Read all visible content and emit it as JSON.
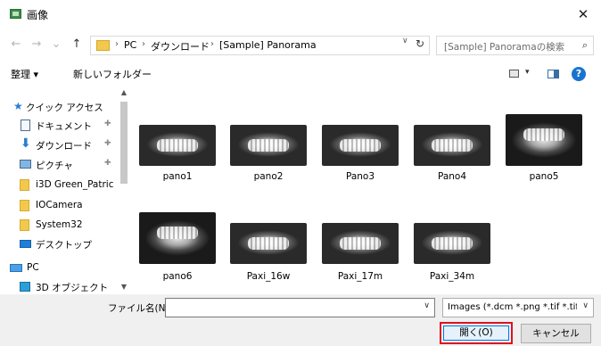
{
  "window": {
    "title": "画像",
    "close_glyph": "✕"
  },
  "nav": {
    "back": "←",
    "forward": "→",
    "recent": "⌄",
    "up": "↑"
  },
  "address": {
    "crumbs": [
      "PC",
      "ダウンロード",
      "[Sample] Panorama"
    ],
    "separator": "›",
    "dropdown": "∨",
    "refresh": "↻"
  },
  "search": {
    "placeholder": "[Sample] Panoramaの検索",
    "icon": "⌕"
  },
  "toolbar": {
    "organize": "整理 ▾",
    "new_folder": "新しいフォルダー",
    "view_dropdown": "▾",
    "help": "?"
  },
  "sidebar": {
    "items": [
      {
        "label": "クイック アクセス",
        "icon": "star-icon"
      },
      {
        "label": "ドキュメント",
        "icon": "document-icon",
        "pinned": true
      },
      {
        "label": "ダウンロード",
        "icon": "download-icon",
        "pinned": true
      },
      {
        "label": "ピクチャ",
        "icon": "pictures-icon",
        "pinned": true
      },
      {
        "label": "i3D Green_Patric",
        "icon": "folder-icon"
      },
      {
        "label": "IOCamera",
        "icon": "folder-icon"
      },
      {
        "label": "System32",
        "icon": "folder-icon"
      },
      {
        "label": "デスクトップ",
        "icon": "desktop-icon"
      },
      {
        "label": "PC",
        "icon": "pc-icon"
      },
      {
        "label": "3D オブジェクト",
        "icon": "3d-objects-icon"
      }
    ],
    "pin_glyph": "✚",
    "scroll_up": "▲",
    "scroll_down": "▼"
  },
  "files": [
    {
      "name": "pano1"
    },
    {
      "name": "pano2"
    },
    {
      "name": "Pano3"
    },
    {
      "name": "Pano4"
    },
    {
      "name": "pano5"
    },
    {
      "name": "pano6"
    },
    {
      "name": "Paxi_16w"
    },
    {
      "name": "Paxi_17m"
    },
    {
      "name": "Paxi_34m"
    }
  ],
  "footer": {
    "filename_label": "ファイル名(N):",
    "filename_value": "",
    "filename_dropdown": "∨",
    "filter_selected": "Images (*.dcm *.png *.tif *.tiff *.",
    "filter_dropdown": "∨",
    "open_label": "開く(O)",
    "cancel_label": "キャンセル"
  },
  "colors": {
    "highlight_border": "#e0111e",
    "accent": "#0078d7",
    "folder": "#f2c94c"
  }
}
